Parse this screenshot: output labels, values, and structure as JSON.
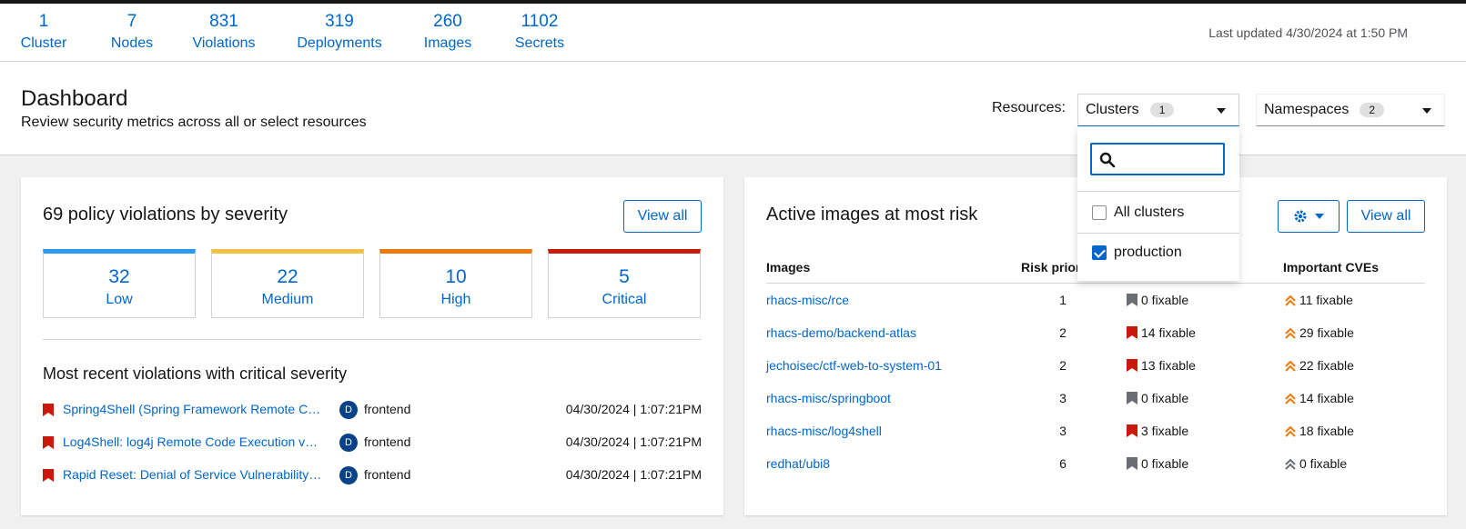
{
  "summary": {
    "stats": [
      {
        "num": "1",
        "label": "Cluster"
      },
      {
        "num": "7",
        "label": "Nodes"
      },
      {
        "num": "831",
        "label": "Violations"
      },
      {
        "num": "319",
        "label": "Deployments"
      },
      {
        "num": "260",
        "label": "Images"
      },
      {
        "num": "1102",
        "label": "Secrets"
      }
    ],
    "last_updated": "Last updated 4/30/2024 at 1:50 PM"
  },
  "header": {
    "title": "Dashboard",
    "subtitle": "Review security metrics across all or select resources",
    "resources_label": "Resources:",
    "clusters_select": {
      "label": "Clusters",
      "count": "1"
    },
    "namespaces_select": {
      "label": "Namespaces",
      "count": "2"
    }
  },
  "cluster_menu": {
    "search_placeholder": "",
    "items": [
      {
        "label": "All clusters",
        "checked": false
      },
      {
        "label": "production",
        "checked": true
      }
    ]
  },
  "violations_card": {
    "title": "69 policy violations by severity",
    "view_all": "View all",
    "severities": [
      {
        "count": "32",
        "label": "Low",
        "color": "#2b9af3"
      },
      {
        "count": "22",
        "label": "Medium",
        "color": "#f4c145"
      },
      {
        "count": "10",
        "label": "High",
        "color": "#ec7a08"
      },
      {
        "count": "5",
        "label": "Critical",
        "color": "#c9190b"
      }
    ],
    "recent_title": "Most recent violations with critical severity",
    "recent": [
      {
        "name": "Spring4Shell (Spring Framework Remote Co...",
        "badge": "D",
        "deployment": "frontend",
        "time": "04/30/2024 | 1:07:21PM"
      },
      {
        "name": "Log4Shell: log4j Remote Code Execution vu...",
        "badge": "D",
        "deployment": "frontend",
        "time": "04/30/2024 | 1:07:21PM"
      },
      {
        "name": "Rapid Reset: Denial of Service Vulnerability i...",
        "badge": "D",
        "deployment": "frontend",
        "time": "04/30/2024 | 1:07:21PM"
      }
    ]
  },
  "images_card": {
    "title": "Active images at most risk",
    "view_all": "View all",
    "columns": {
      "images": "Images",
      "risk": "Risk prior",
      "cves": "Important CVEs"
    },
    "rows": [
      {
        "image": "rhacs-misc/rce",
        "risk": "1",
        "fixable": "0 fixable",
        "critical": false,
        "cves": "11 fixable",
        "cve_color": "#ec7a08"
      },
      {
        "image": "rhacs-demo/backend-atlas",
        "risk": "2",
        "fixable": "14 fixable",
        "critical": true,
        "cves": "29 fixable",
        "cve_color": "#ec7a08"
      },
      {
        "image": "jechoisec/ctf-web-to-system-01",
        "risk": "2",
        "fixable": "13 fixable",
        "critical": true,
        "cves": "22 fixable",
        "cve_color": "#ec7a08"
      },
      {
        "image": "rhacs-misc/springboot",
        "risk": "3",
        "fixable": "0 fixable",
        "critical": false,
        "cves": "14 fixable",
        "cve_color": "#ec7a08"
      },
      {
        "image": "rhacs-misc/log4shell",
        "risk": "3",
        "fixable": "3 fixable",
        "critical": true,
        "cves": "18 fixable",
        "cve_color": "#ec7a08"
      },
      {
        "image": "redhat/ubi8",
        "risk": "6",
        "fixable": "0 fixable",
        "critical": false,
        "cves": "0 fixable",
        "cve_color": "#6a6e73"
      }
    ]
  },
  "icons": {
    "flag_critical": "flag-icon",
    "flag_gray": "flag-icon",
    "cve": "angle-double-up-icon",
    "gear": "gear-icon",
    "search": "search-icon"
  }
}
